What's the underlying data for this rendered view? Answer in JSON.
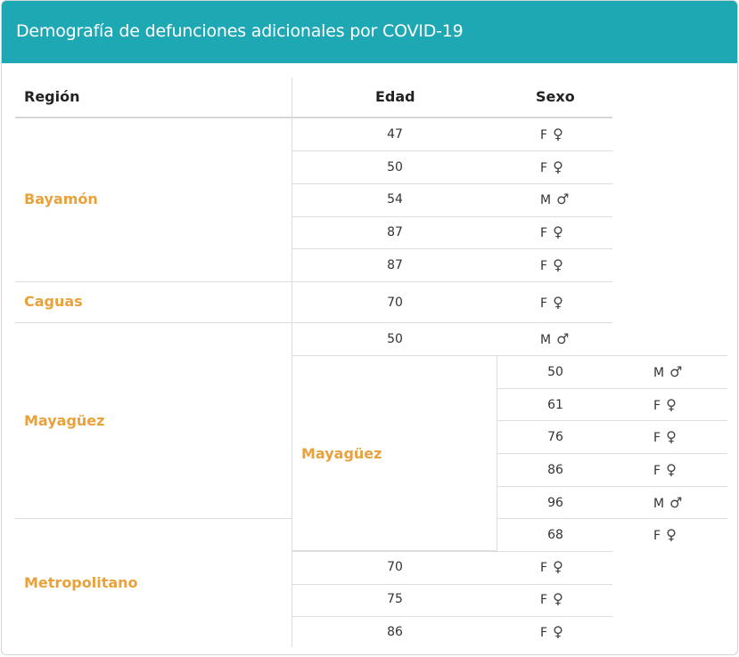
{
  "header": {
    "title": "Demografía de defunciones adicionales por COVID-19"
  },
  "table": {
    "headers": {
      "region": "Región",
      "edad": "Edad",
      "sexo": "Sexo"
    },
    "regions": [
      "Bayamón",
      "Caguas",
      "Mayagüez",
      "Metropolitano"
    ],
    "subregion": "Mayagüez",
    "rows": [
      {
        "edad": "47",
        "sexo": "F",
        "icon": "female-icon"
      },
      {
        "edad": "50",
        "sexo": "F",
        "icon": "female-icon"
      },
      {
        "edad": "54",
        "sexo": "M",
        "icon": "male-icon"
      },
      {
        "edad": "87",
        "sexo": "F",
        "icon": "female-icon"
      },
      {
        "edad": "87",
        "sexo": "F",
        "icon": "female-icon"
      },
      {
        "edad": "70",
        "sexo": "F",
        "icon": "female-icon"
      },
      {
        "edad": "50",
        "sexo": "M",
        "icon": "male-icon"
      },
      {
        "edad": "70",
        "sexo": "F",
        "icon": "female-icon"
      },
      {
        "edad": "75",
        "sexo": "F",
        "icon": "female-icon"
      },
      {
        "edad": "86",
        "sexo": "F",
        "icon": "female-icon"
      }
    ],
    "subrows": [
      {
        "edad": "50",
        "sexo": "M",
        "icon": "male-icon"
      },
      {
        "edad": "61",
        "sexo": "F",
        "icon": "female-icon"
      },
      {
        "edad": "76",
        "sexo": "F",
        "icon": "female-icon"
      },
      {
        "edad": "86",
        "sexo": "F",
        "icon": "female-icon"
      },
      {
        "edad": "96",
        "sexo": "M",
        "icon": "male-icon"
      },
      {
        "edad": "68",
        "sexo": "F",
        "icon": "female-icon"
      }
    ]
  }
}
